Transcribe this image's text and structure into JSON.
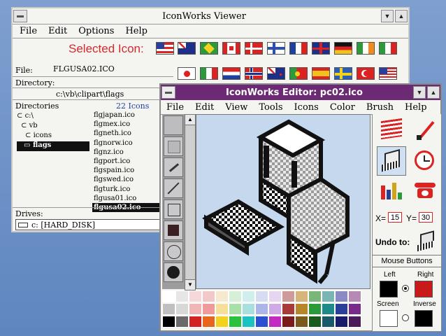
{
  "viewer": {
    "title": "IconWorks Viewer",
    "menu": [
      "File",
      "Edit",
      "Options",
      "Help"
    ],
    "selected_icon_label": "Selected Icon:",
    "file_label": "File:",
    "file_value": "FLGUSA02.ICO",
    "directory_label": "Directory:",
    "directory_value": "c:\\vb\\clipart\\flags",
    "directories_label": "Directories",
    "icon_count": "22 Icons",
    "dir_tree": [
      "c:\\",
      "vb",
      "icons",
      "flags"
    ],
    "files": [
      "flgjapan.ico",
      "flgmex.ico",
      "flgneth.ico",
      "flgnorw.ico",
      "flgnz.ico",
      "flgport.ico",
      "flgspain.ico",
      "flgswed.ico",
      "flgturk.ico",
      "flgusa01.ico",
      "flgusa02.ico"
    ],
    "selected_file": "flgusa02.ico",
    "drives_label": "Drives:",
    "drive_value": "c: [HARD_DISK]"
  },
  "editor": {
    "title": "IconWorks Editor: pc02.ico",
    "menu": [
      "File",
      "Edit",
      "View",
      "Tools",
      "Icons",
      "Color",
      "Brush",
      "Help"
    ],
    "x_label": "X=",
    "x_value": "15",
    "y_label": "Y=",
    "y_value": "30",
    "undo_label": "Undo to:",
    "mouse_buttons_label": "Mouse Buttons",
    "left_label": "Left",
    "right_label": "Right",
    "screen_label": "Screen",
    "inverse_label": "Inverse"
  },
  "colors": {
    "left_button": "#000000",
    "right_button": "#c81a1a",
    "screen": "#ffffff",
    "inverse": "#000000",
    "editor_title": "#6b2a73",
    "canvas_bg": "#c6d8ee"
  }
}
